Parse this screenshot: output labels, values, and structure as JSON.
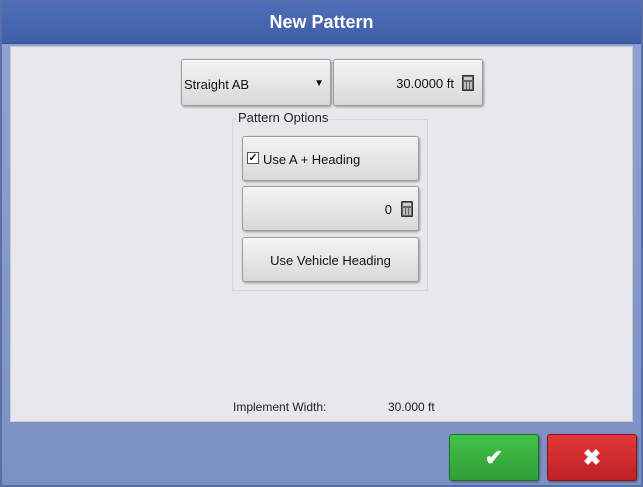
{
  "window": {
    "title": "New Pattern"
  },
  "pattern": {
    "type_value": "Straight AB",
    "dropdown_arrow": "▼",
    "width_value": "30.0000 ft"
  },
  "pattern_options": {
    "label": "Pattern Options",
    "use_a_heading_label": "Use A + Heading",
    "use_a_heading_checked": true,
    "check_glyph": "✓",
    "heading_value": "0",
    "use_vehicle_heading_label": "Use Vehicle Heading"
  },
  "implement": {
    "label": "Implement Width:",
    "value": "30.000 ft"
  },
  "actions": {
    "ok_glyph": "✔",
    "cancel_glyph": "✖",
    "ok_color": "#34a83a",
    "cancel_color": "#d12c2f"
  }
}
